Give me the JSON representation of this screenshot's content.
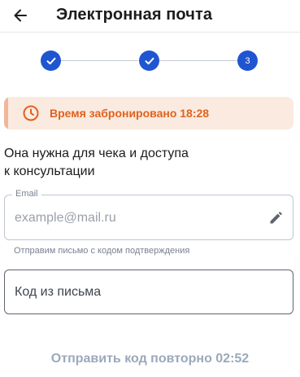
{
  "header": {
    "title": "Электронная почта",
    "back_icon": "arrow-left-icon"
  },
  "stepper": {
    "steps": [
      {
        "state": "completed",
        "icon": "check-icon"
      },
      {
        "state": "completed",
        "icon": "check-icon"
      },
      {
        "state": "current",
        "label": "3"
      }
    ],
    "accent_color": "#1f55d1"
  },
  "banner": {
    "text": "Время забронировано 18:28",
    "icon": "clock-icon",
    "color": "#e0621f"
  },
  "description": {
    "line1": "Она нужна для чека и доступа",
    "line2": "к консультации"
  },
  "email": {
    "label": "Email",
    "placeholder": "example@mail.ru",
    "value": "",
    "edit_icon": "pencil-icon",
    "hint": "Отправим письмо с кодом подтверждения"
  },
  "code": {
    "placeholder": "Код из письма",
    "value": ""
  },
  "resend": {
    "label": "Отправить код повторно 02:52"
  }
}
